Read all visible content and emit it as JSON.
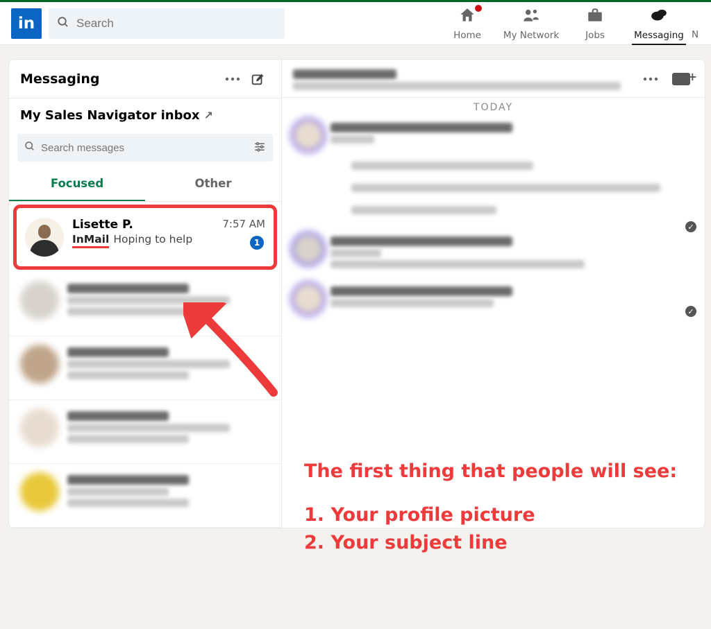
{
  "nav": {
    "search_placeholder": "Search",
    "home": "Home",
    "network": "My Network",
    "jobs": "Jobs",
    "messaging": "Messaging",
    "cutoff": "N"
  },
  "messaging": {
    "title": "Messaging",
    "sales_nav": "My Sales Navigator inbox",
    "search_placeholder": "Search messages",
    "tab_focused": "Focused",
    "tab_other": "Other"
  },
  "featured": {
    "name": "Lisette P.",
    "time": "7:57 AM",
    "tag": "InMail",
    "subject": "Hoping to help",
    "unread": "1"
  },
  "thread": {
    "today": "TODAY"
  },
  "annotation": {
    "heading": "The first thing that people will see:",
    "line1": "1. Your profile picture",
    "line2": "2. Your subject line"
  }
}
